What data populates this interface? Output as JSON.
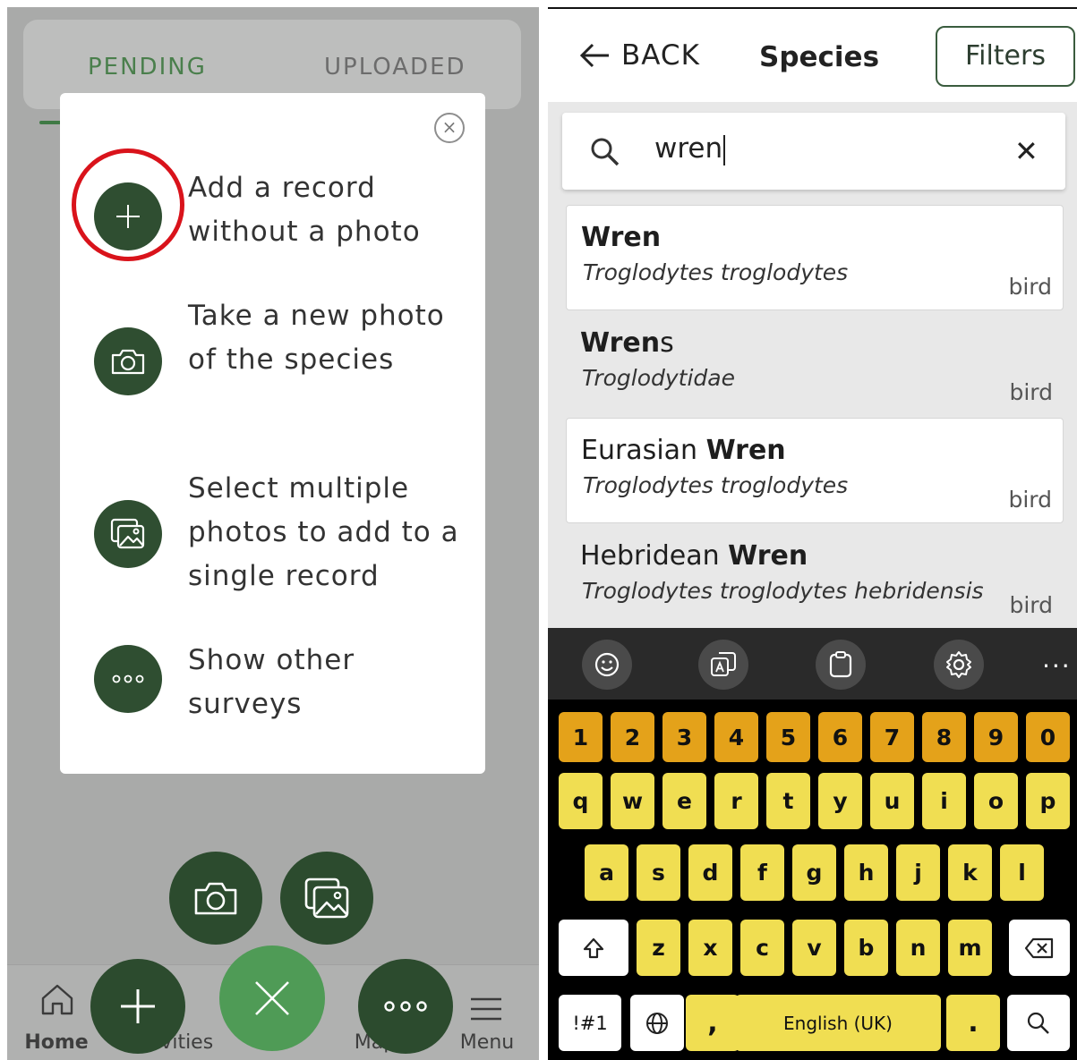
{
  "left": {
    "tabs": {
      "pending": "PENDING",
      "uploaded": "UPLOADED"
    },
    "modal": {
      "close_icon": "×",
      "options": [
        {
          "icon": "plus-icon",
          "text": "Add a record without a photo",
          "highlighted": true
        },
        {
          "icon": "camera-icon",
          "text": "Take a new photo of the species"
        },
        {
          "icon": "gallery-icon",
          "text": "Select multiple photos to add to a single record"
        },
        {
          "icon": "ellipsis-icon",
          "text": "Show other surveys"
        }
      ]
    },
    "nav": {
      "home": "Home",
      "activities": "Activities",
      "map": "Map",
      "menu": "Menu"
    },
    "colors": {
      "dark_green": "#2c4b2e",
      "light_green": "#4f9b56",
      "highlight_red": "#d9131b"
    }
  },
  "right": {
    "header": {
      "back": "BACK",
      "title": "Species",
      "filters": "Filters"
    },
    "search": {
      "value": "wren"
    },
    "results": [
      {
        "pre": "",
        "match": "Wren",
        "post": "",
        "scientific": "Troglodytes troglodytes",
        "group": "bird"
      },
      {
        "pre": "",
        "match": "Wren",
        "post": "s",
        "scientific": "Troglodytidae",
        "group": "bird"
      },
      {
        "pre": "Eurasian ",
        "match": "Wren",
        "post": "",
        "scientific": "Troglodytes troglodytes",
        "group": "bird"
      },
      {
        "pre": "Hebridean ",
        "match": "Wren",
        "post": "",
        "scientific": "Troglodytes troglodytes hebridensis",
        "group": "bird"
      }
    ],
    "keyboard": {
      "toolbar_more": "···",
      "numbers": [
        "1",
        "2",
        "3",
        "4",
        "5",
        "6",
        "7",
        "8",
        "9",
        "0"
      ],
      "row1": [
        "q",
        "w",
        "e",
        "r",
        "t",
        "y",
        "u",
        "i",
        "o",
        "p"
      ],
      "row2": [
        "a",
        "s",
        "d",
        "f",
        "g",
        "h",
        "j",
        "k",
        "l"
      ],
      "row3": [
        "z",
        "x",
        "c",
        "v",
        "b",
        "n",
        "m"
      ],
      "symbols": "!#1",
      "comma": ",",
      "space": "English (UK)",
      "period": "."
    }
  }
}
